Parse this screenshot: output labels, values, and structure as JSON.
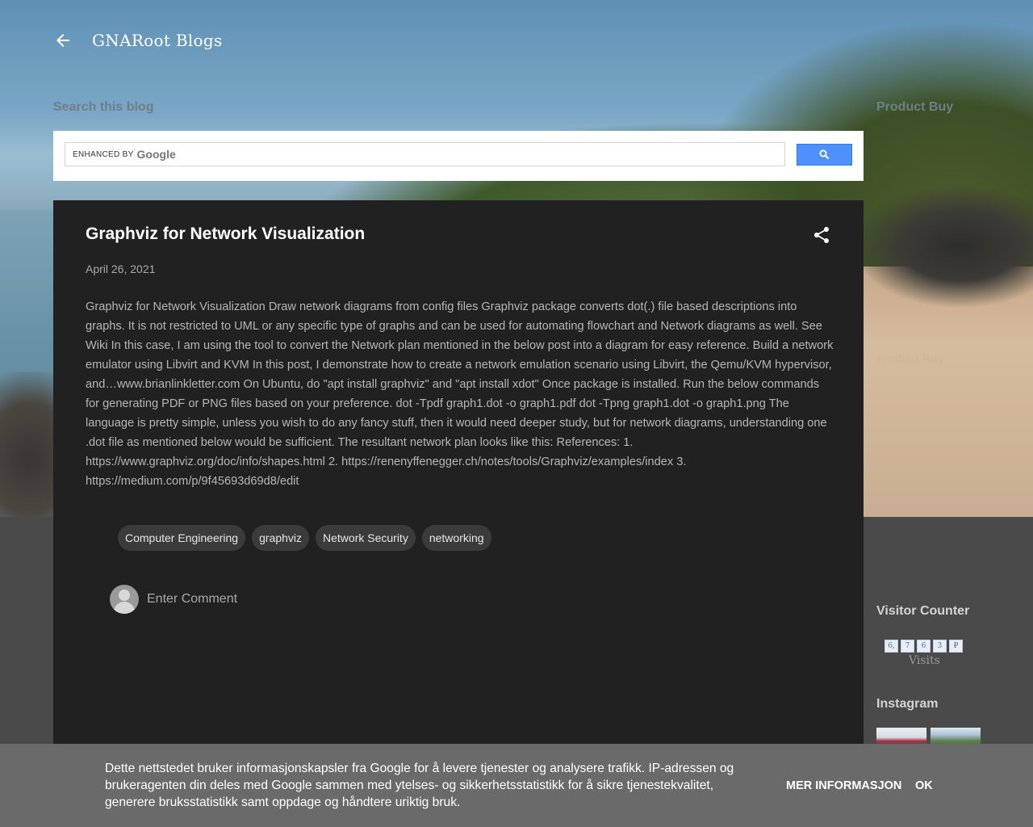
{
  "header": {
    "blog_title": "GNARoot Blogs"
  },
  "search": {
    "section_label": "Search this blog",
    "enhanced_by": "ENHANCED BY",
    "google_word": "Google"
  },
  "sidebar": {
    "product_buy_label": "Product Buy",
    "product_buy_faint": "Product Buy",
    "visitor_counter_title": "Visitor Counter",
    "counter_digits": [
      "6,",
      "7",
      "6",
      "3",
      "₽"
    ],
    "visits_label": "Visits",
    "instagram_title": "Instagram"
  },
  "post": {
    "title": "Graphviz for Network Visualization",
    "date": "April 26, 2021",
    "body": "Graphviz for Network Visualization Draw network diagrams from config files Graphviz package converts dot(.) file based descriptions into graphs. It is not restricted to UML or any specific type of graphs and can be used for automating flowchart and Network diagrams as well. See Wiki In this case, I am using the tool to convert the Network plan mentioned in the below post into a diagram for easy reference. Build a network emulator using Libvirt and KVM In this post, I demonstrate how to create a network emulation scenario using Libvirt, the Qemu/KVM hypervisor, and…www.brianlinkletter.com On Ubuntu, do \"apt install graphviz\" and \"apt install xdot\" Once package is installed. Run the below commands for generating PDF or PNG files based on your preference. dot -Tpdf graph1.dot -o graph1.pdf dot -Tpng graph1.dot -o graph1.png The language is pretty simple, unless you wish to do any fancy stuff, then it would need deeper study, but for network diagrams, understanding one .dot file as mentioned below would be sufficient. The resultant network plan looks like this: References: 1. https://www.graphviz.org/doc/info/shapes.html 2. https://renenyffenegger.ch/notes/tools/Graphviz/examples/index 3. https://medium.com/p/9f45693d69d8/edit",
    "labels": [
      "Computer Engineering",
      "graphviz",
      "Network Security",
      "networking"
    ],
    "comment_placeholder": "Enter Comment"
  },
  "cookie": {
    "text": "Dette nettstedet bruker informasjonskapsler fra Google for å levere tjenester og analysere trafikk. IP-adressen og brukeragenten din deles med Google sammen med ytelses- og sikkerhetsstatistikk for å sikre tjenestekvalitet, generere bruksstatistikk samt oppdage og håndtere uriktig bruk.",
    "more_label": "MER INFORMASJON",
    "ok_label": "OK"
  },
  "colors": {
    "post_background": "#212121",
    "search_button": "#4d90fe",
    "cookie_bar": "#6a6a6a"
  }
}
